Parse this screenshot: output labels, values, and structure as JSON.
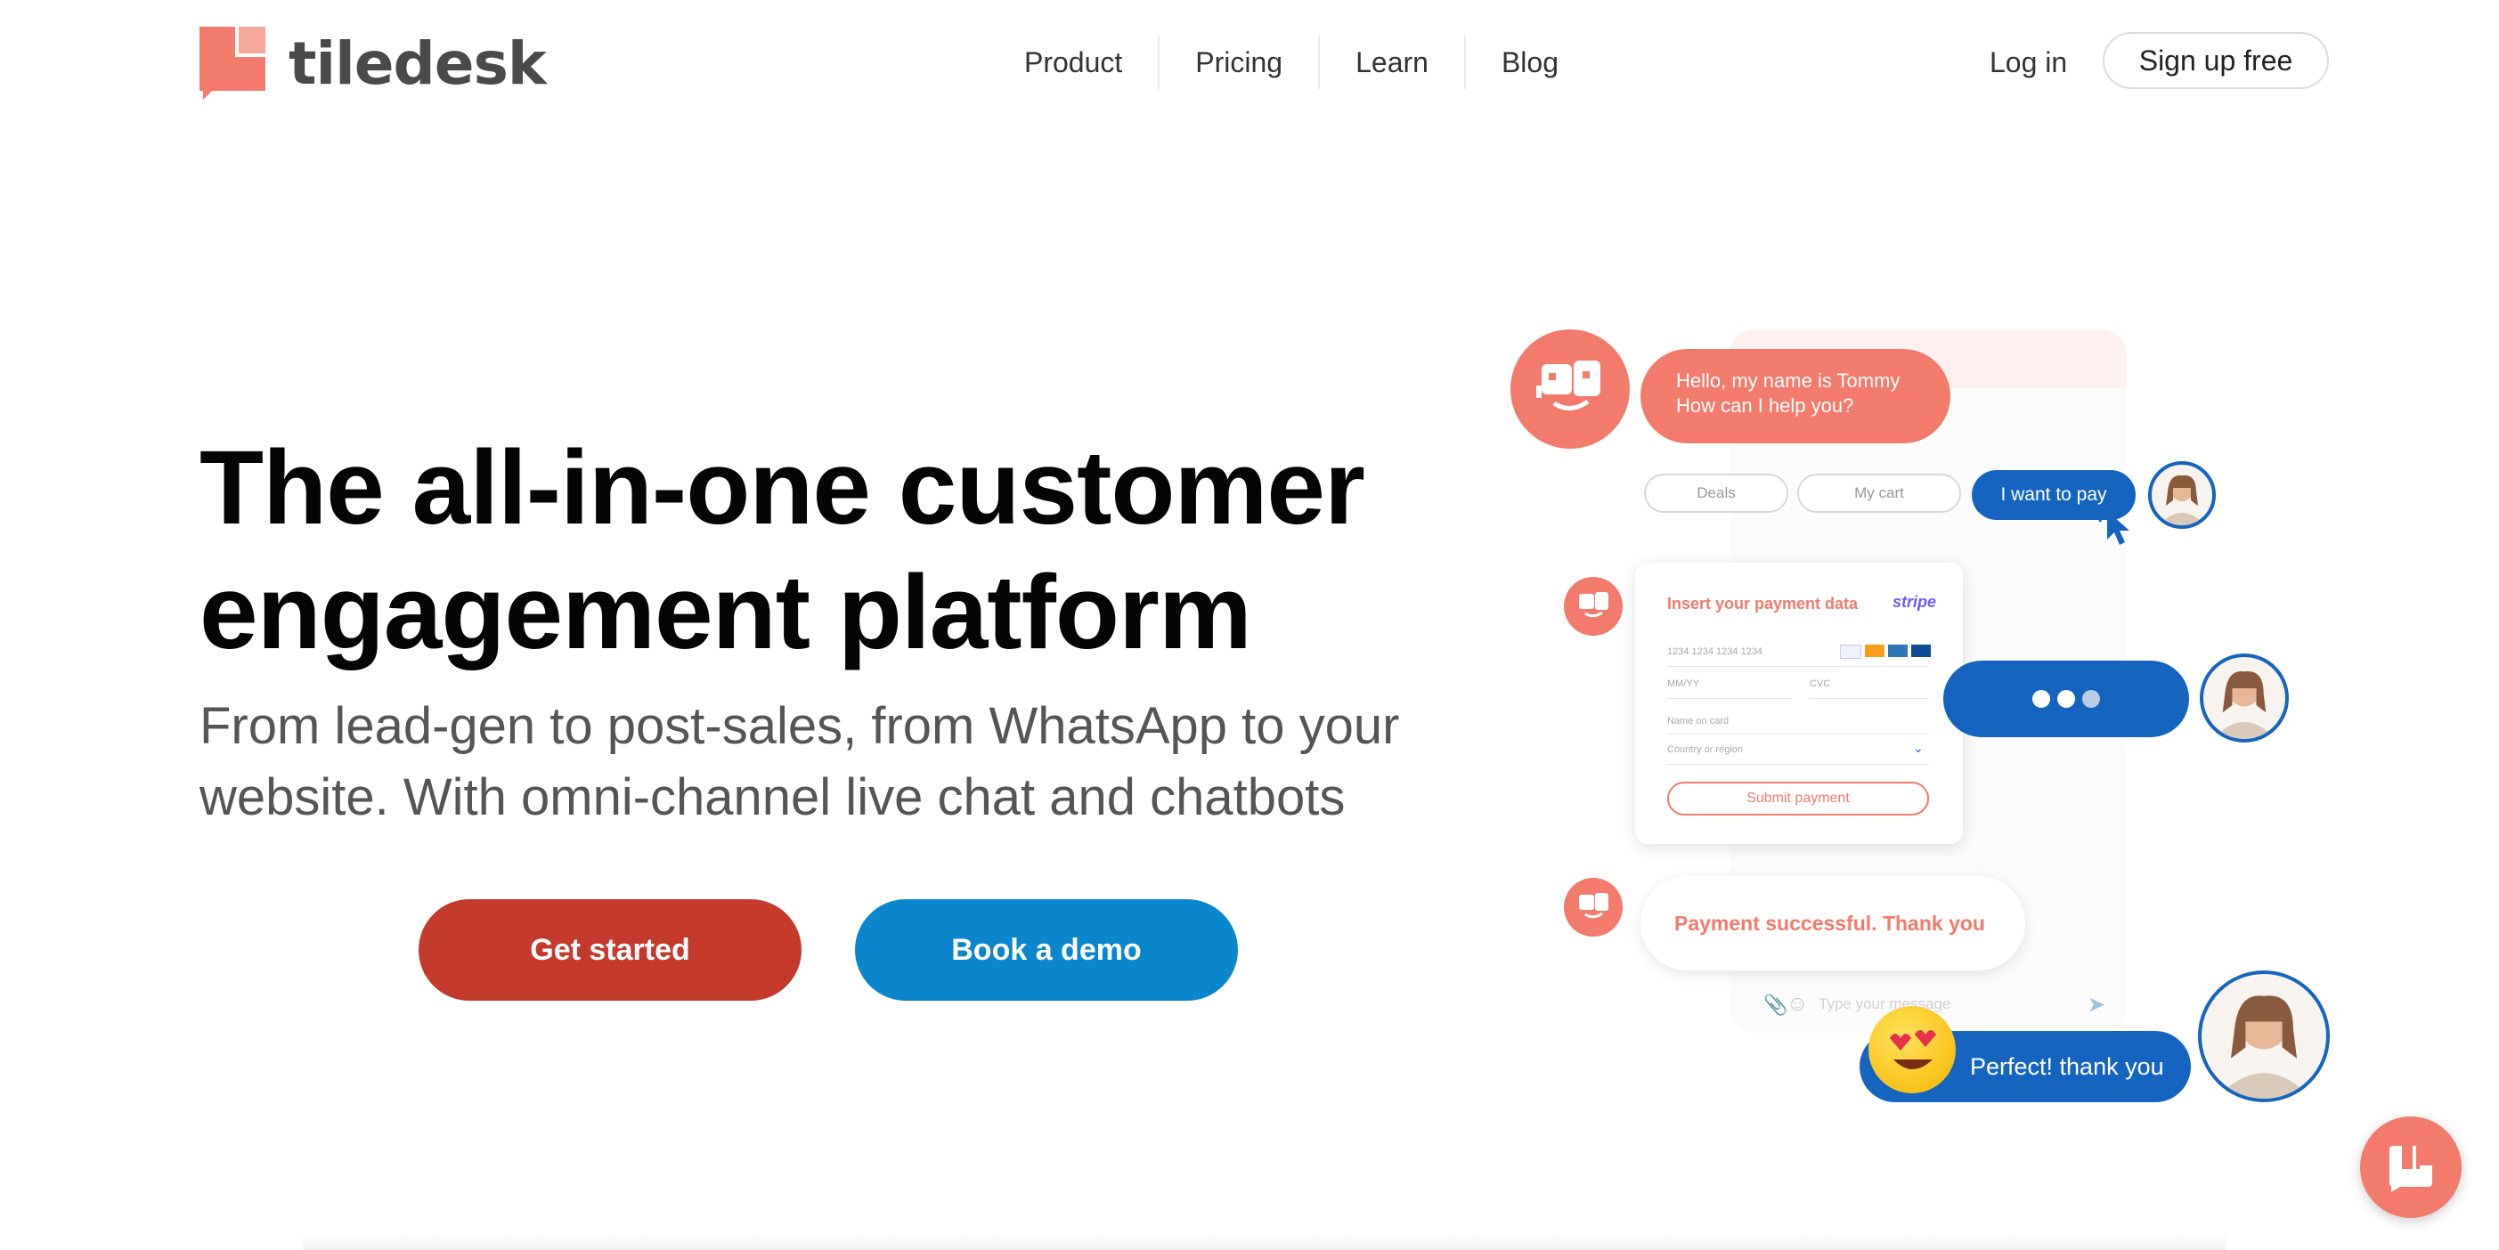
{
  "brand": {
    "name": "tiledesk",
    "color": "#f27b6b"
  },
  "nav": {
    "items": [
      {
        "label": "Product"
      },
      {
        "label": "Pricing"
      },
      {
        "label": "Learn"
      },
      {
        "label": "Blog"
      }
    ],
    "login_label": "Log in",
    "signup_label": "Sign up free"
  },
  "hero": {
    "headline_line1": "The all-in-one customer",
    "headline_line2": "engagement platform",
    "sub_line1": "From lead-gen to post-sales, from WhatsApp to your",
    "sub_line2": "website. With omni-channel live chat and chatbots",
    "cta_primary": "Get started",
    "cta_secondary": "Book a demo",
    "colors": {
      "primary": "#c43a2c",
      "secondary": "#0a86cc",
      "user_bubble": "#1565c0"
    }
  },
  "chat": {
    "bot_greeting_line1": "Hello, my name is Tommy",
    "bot_greeting_line2": "How can I help you?",
    "chips": [
      "Deals",
      "My cart"
    ],
    "user_choice": "I want to pay",
    "payment": {
      "title": "Insert your payment data",
      "provider": "stripe",
      "card_number_placeholder": "1234 1234 1234 1234",
      "expiry_placeholder": "MM/YY",
      "cvc_placeholder": "CVC",
      "name_label": "Name on card",
      "country_placeholder": "Country or region",
      "submit_label": "Submit payment"
    },
    "success_message": "Payment successful. Thank you",
    "composer_placeholder": "Type your message",
    "user_final": "Perfect! thank you"
  }
}
